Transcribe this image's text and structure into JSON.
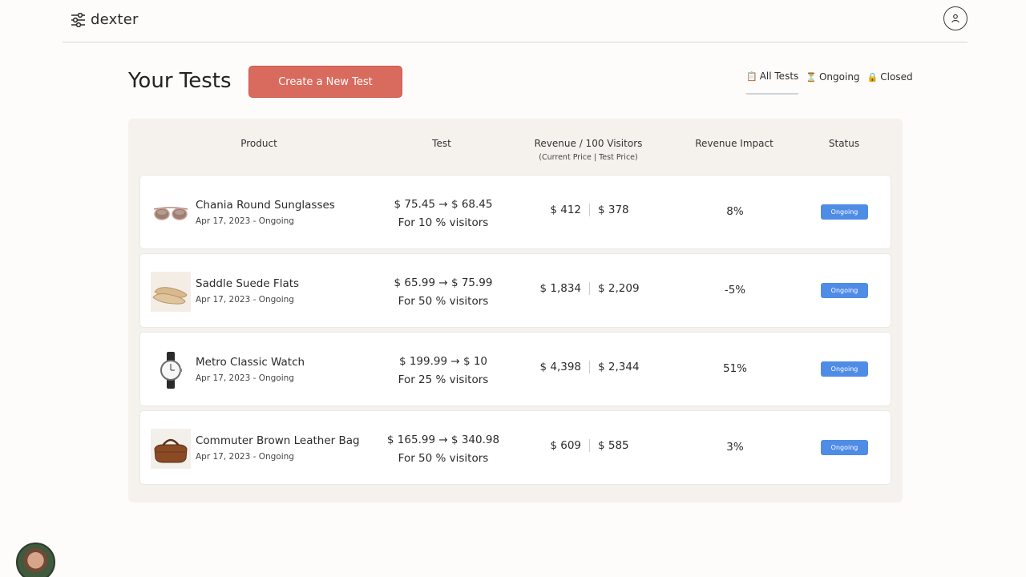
{
  "app": {
    "name": "dexter"
  },
  "page": {
    "title": "Your Tests",
    "create_label": "Create a New Test"
  },
  "filters": [
    {
      "label": "All Tests",
      "icon": "clipboard-icon",
      "active": true
    },
    {
      "label": "Ongoing",
      "icon": "hourglass-icon",
      "active": false
    },
    {
      "label": "Closed",
      "icon": "lock-icon",
      "active": false
    }
  ],
  "table": {
    "headers": {
      "product": "Product",
      "test": "Test",
      "revenue": "Revenue / 100 Visitors",
      "revenue_sub": "(Current Price | Test Price)",
      "impact": "Revenue Impact",
      "status": "Status"
    },
    "rows": [
      {
        "name": "Chania Round Sunglasses",
        "date": "Apr 17, 2023 - Ongoing",
        "price_line": "$ 75.45 → $ 68.45",
        "visitors": "For 10 % visitors",
        "rev_current": "$ 412",
        "rev_test": "$ 378",
        "impact": "8%",
        "status": "Ongoing",
        "thumb": "sunglasses-thumb"
      },
      {
        "name": "Saddle Suede Flats",
        "date": "Apr 17, 2023 - Ongoing",
        "price_line": "$ 65.99 → $ 75.99",
        "visitors": "For 50 % visitors",
        "rev_current": "$ 1,834",
        "rev_test": "$ 2,209",
        "impact": "-5%",
        "status": "Ongoing",
        "thumb": "flats-thumb"
      },
      {
        "name": "Metro Classic Watch",
        "date": "Apr 17, 2023 - Ongoing",
        "price_line": "$ 199.99 → $ 10",
        "visitors": "For 25 % visitors",
        "rev_current": "$ 4,398",
        "rev_test": "$ 2,344",
        "impact": "51%",
        "status": "Ongoing",
        "thumb": "watch-thumb"
      },
      {
        "name": "Commuter Brown Leather Bag",
        "date": "Apr 17, 2023 - Ongoing",
        "price_line": "$ 165.99 → $ 340.98",
        "visitors": "For 50 % visitors",
        "rev_current": "$ 609",
        "rev_test": "$ 585",
        "impact": "3%",
        "status": "Ongoing",
        "thumb": "bag-thumb"
      }
    ]
  },
  "colors": {
    "accent": "#d96b5e",
    "badge": "#4f8ce6",
    "panel": "#f5f2ee"
  }
}
